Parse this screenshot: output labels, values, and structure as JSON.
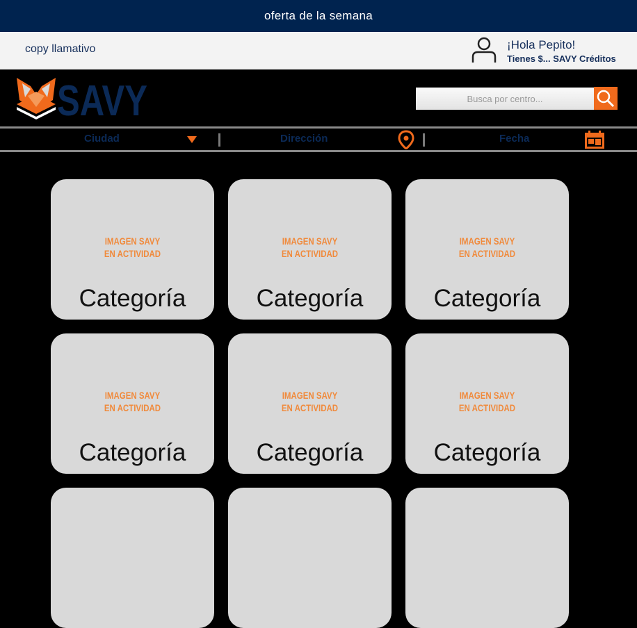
{
  "topbar": {
    "offer": "oferta de la semana"
  },
  "greeting": {
    "copy": "copy llamativo",
    "hola": "¡Hola Pepito!",
    "creditos": "Tienes $... SAVY Créditos"
  },
  "brand": {
    "name": "SAVY"
  },
  "search": {
    "placeholder": "Busca por centro..."
  },
  "filters": {
    "ciudad": "Ciudad",
    "direccion": "Dirección",
    "fecha": "Fecha"
  },
  "cards": [
    {
      "image_text_line1": "IMAGEN SAVY",
      "image_text_line2": "EN ACTIVIDAD",
      "title": "Categoría"
    },
    {
      "image_text_line1": "IMAGEN SAVY",
      "image_text_line2": "EN ACTIVIDAD",
      "title": "Categoría"
    },
    {
      "image_text_line1": "IMAGEN SAVY",
      "image_text_line2": "EN ACTIVIDAD",
      "title": "Categoría"
    },
    {
      "image_text_line1": "IMAGEN SAVY",
      "image_text_line2": "EN ACTIVIDAD",
      "title": "Categoría"
    },
    {
      "image_text_line1": "IMAGEN SAVY",
      "image_text_line2": "EN ACTIVIDAD",
      "title": "Categoría"
    },
    {
      "image_text_line1": "IMAGEN SAVY",
      "image_text_line2": "EN ACTIVIDAD",
      "title": "Categoría"
    },
    {
      "image_text_line1": "",
      "image_text_line2": "",
      "title": ""
    },
    {
      "image_text_line1": "",
      "image_text_line2": "",
      "title": ""
    },
    {
      "image_text_line1": "",
      "image_text_line2": "",
      "title": ""
    }
  ],
  "colors": {
    "navy": "#00234f",
    "orange": "#f06a1c",
    "card": "#d9d9d9"
  },
  "icons": [
    "user-icon",
    "fox-logo-icon",
    "search-icon",
    "caret-down-icon",
    "location-pin-icon",
    "calendar-icon"
  ]
}
